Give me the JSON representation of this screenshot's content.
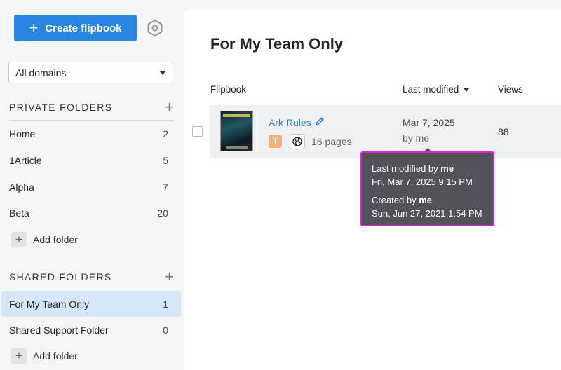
{
  "sidebar": {
    "create_label": "Create flipbook",
    "domain_select": "All domains",
    "private_title": "PRIVATE FOLDERS",
    "shared_title": "SHARED FOLDERS",
    "add_folder_label": "Add folder",
    "private_folders": [
      {
        "name": "Home",
        "count": "2"
      },
      {
        "name": "1Article",
        "count": "5"
      },
      {
        "name": "Alpha",
        "count": "7"
      },
      {
        "name": "Beta",
        "count": "20"
      }
    ],
    "shared_folders": [
      {
        "name": "For My Team Only",
        "count": "1"
      },
      {
        "name": "Shared Support Folder",
        "count": "0"
      }
    ]
  },
  "main": {
    "title": "For My Team Only",
    "columns": {
      "flipbook": "Flipbook",
      "last_modified": "Last modified",
      "views": "Views"
    },
    "row": {
      "title": "Ark Rules",
      "badge": "T",
      "pages": "16 pages",
      "modified_date": "Mar 7, 2025",
      "modified_by": "by me",
      "views": "88"
    }
  },
  "tooltip": {
    "mod_prefix": "Last modified by ",
    "mod_user": "me",
    "mod_time": "Fri, Mar 7, 2025 9:15 PM",
    "created_prefix": "Created by ",
    "created_user": "me",
    "created_time": "Sun, Jun 27, 2021 1:54 PM"
  },
  "colors": {
    "accent": "#2a85e0",
    "active_folder": "#d6e8f8",
    "link": "#2a7fd4",
    "tooltip_bg": "#505359",
    "tooltip_border": "#e020d0"
  },
  "icons": [
    "plus-icon",
    "settings-hexagon-icon",
    "chevron-down-icon",
    "pencil-icon",
    "globe-icon"
  ]
}
